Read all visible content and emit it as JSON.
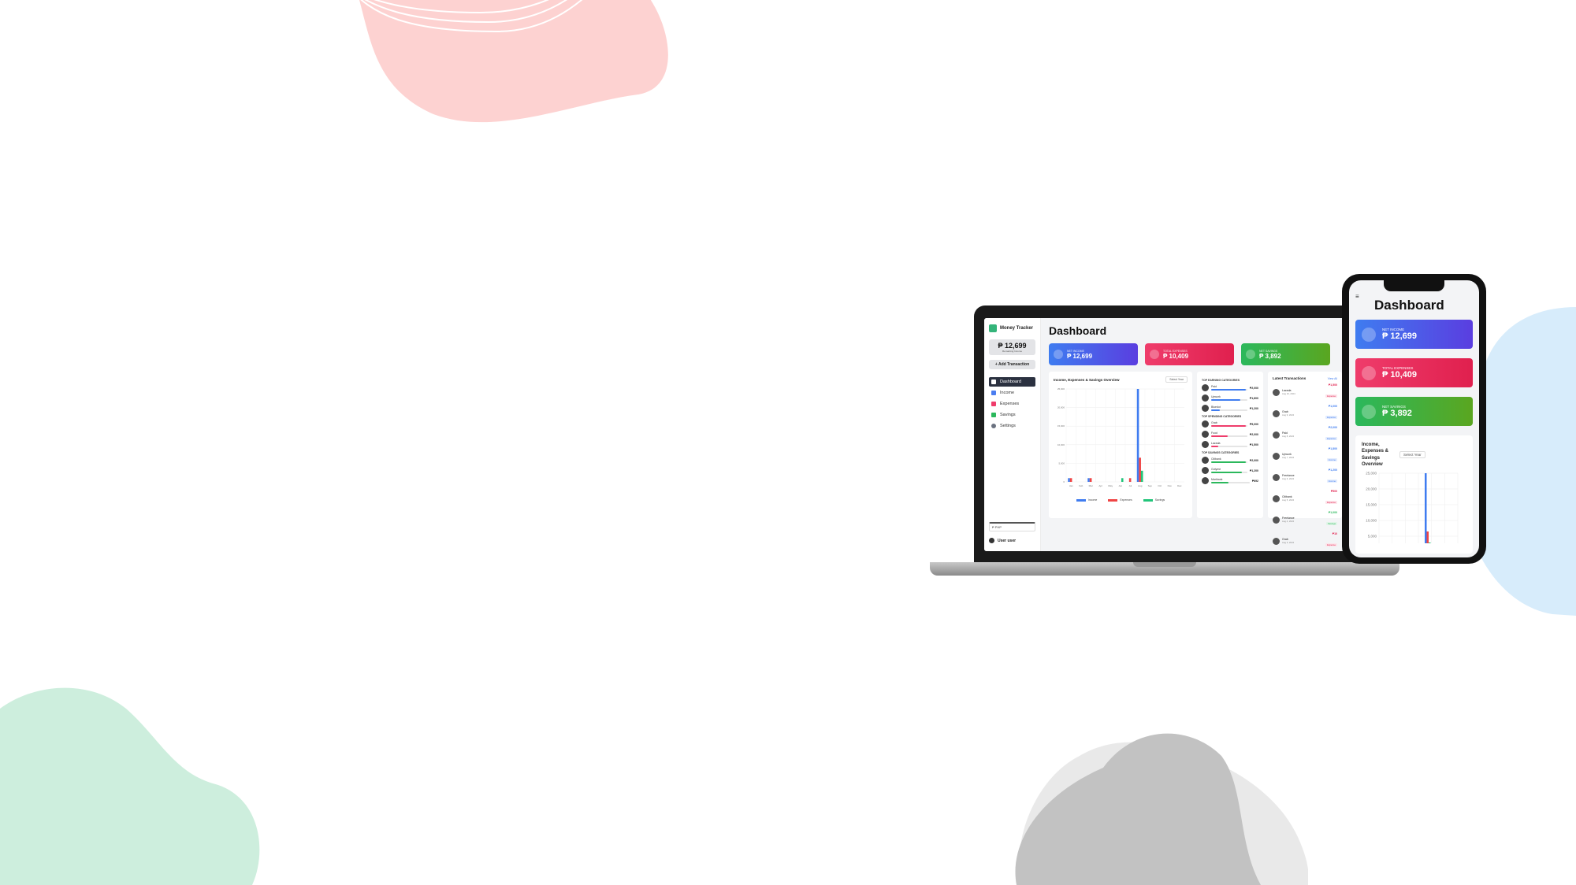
{
  "laptop": {
    "brand": "Money Tracker",
    "balance": "₱ 12,699",
    "balance_label": "Remaining Income",
    "add_transaction": "+ Add Transaction",
    "nav": [
      {
        "label": "Dashboard",
        "icon": "home-icon",
        "color": "#ffffff"
      },
      {
        "label": "Income",
        "icon": "income-icon",
        "color": "#4a7df0"
      },
      {
        "label": "Expenses",
        "icon": "expenses-icon",
        "color": "#ef3c6b"
      },
      {
        "label": "Savings",
        "icon": "savings-icon",
        "color": "#2bb85c"
      },
      {
        "label": "Settings",
        "icon": "settings-icon",
        "color": "#6b7280"
      }
    ],
    "currency": "₱ PHP",
    "user": "User user",
    "title": "Dashboard",
    "cards": [
      {
        "label": "NET INCOME",
        "value": "₱ 12,699",
        "icon": "wallet-icon"
      },
      {
        "label": "TOTAL EXPENSES",
        "value": "₱ 10,409",
        "icon": "card-icon"
      },
      {
        "label": "NET SAVINGS",
        "value": "₱ 3,892",
        "icon": "piggy-bank-icon"
      }
    ],
    "chart_title": "Income, Expenses & Savings Overview",
    "chart_select": "Select Year",
    "cats": {
      "earning_title": "TOP EARNING CATEGORIES",
      "spending_title": "TOP SPENDING CATEGORIES",
      "savings_title": "TOP SAVINGS CATEGORIES",
      "earning": [
        {
          "name": "Paid",
          "value": "₱2,000",
          "fill": 0.95,
          "color": "#3f7cf0"
        },
        {
          "name": "Upwork",
          "value": "₱1,800",
          "fill": 0.8,
          "color": "#3f7cf0"
        },
        {
          "name": "Bluedot",
          "value": "₱1,200",
          "fill": 0.25,
          "color": "#3f7cf0"
        }
      ],
      "spending": [
        {
          "name": "Grab",
          "value": "₱5,000",
          "fill": 0.95,
          "color": "#ef3c6b"
        },
        {
          "name": "Food",
          "value": "₱2,000",
          "fill": 0.45,
          "color": "#ef3c6b"
        },
        {
          "name": "Lazada",
          "value": "₱1,500",
          "fill": 0.2,
          "color": "#ef3c6b"
        }
      ],
      "savings": [
        {
          "name": "Citibank",
          "value": "₱2,000",
          "fill": 0.95,
          "color": "#2bb85c"
        },
        {
          "name": "Gotyme",
          "value": "₱1,200",
          "fill": 0.85,
          "color": "#2bb85c"
        },
        {
          "name": "Maribank",
          "value": "₱692",
          "fill": 0.45,
          "color": "#2bb85c"
        }
      ]
    },
    "tx_title": "Latest Transactions",
    "tx_link": "View All",
    "transactions": [
      {
        "name": "Lazada",
        "date": "Aug 10, 2024",
        "amount": "₱1,500",
        "type": "Expense",
        "color": "#e0204e",
        "bg": "#fde4ea"
      },
      {
        "name": "Grab",
        "date": "Aug 9, 2024",
        "amount": "₱1,000",
        "type": "Expense",
        "color": "#3f7cf0",
        "bg": "#e3ecfd"
      },
      {
        "name": "Paid",
        "date": "Aug 8, 2024",
        "amount": "₱2,000",
        "type": "Expense",
        "color": "#3f7cf0",
        "bg": "#e3ecfd"
      },
      {
        "name": "Upwork",
        "date": "Aug 7, 2024",
        "amount": "₱1,800",
        "type": "Income",
        "color": "#3f7cf0",
        "bg": "#e3ecfd"
      },
      {
        "name": "Freelance",
        "date": "Aug 6, 2024",
        "amount": "₱1,200",
        "type": "Income",
        "color": "#3f7cf0",
        "bg": "#e3ecfd"
      },
      {
        "name": "Citibank",
        "date": "Aug 5, 2024",
        "amount": "₱500",
        "type": "Expense",
        "color": "#e0204e",
        "bg": "#fde4ea"
      },
      {
        "name": "Freelance",
        "date": "Aug 4, 2024",
        "amount": "₱1,000",
        "type": "Savings",
        "color": "#2bb85c",
        "bg": "#e1f5e8"
      },
      {
        "name": "Grab",
        "date": "Aug 3, 2024",
        "amount": "₱10",
        "type": "Expense",
        "color": "#e0204e",
        "bg": "#fde4ea"
      }
    ]
  },
  "chart_data": {
    "type": "bar",
    "title": "Income, Expenses & Savings Overview",
    "categories": [
      "Jan",
      "Feb",
      "Mar",
      "Apr",
      "May",
      "Jun",
      "Jul",
      "Aug",
      "Sep",
      "Oct",
      "Nov",
      "Dec"
    ],
    "series": [
      {
        "name": "Income",
        "values": [
          1000,
          0,
          1000,
          0,
          0,
          0,
          0,
          25000,
          0,
          0,
          0,
          0
        ],
        "color": "#3f7cf0"
      },
      {
        "name": "Expenses",
        "values": [
          1000,
          0,
          1000,
          0,
          0,
          0,
          1000,
          6500,
          0,
          0,
          0,
          0
        ],
        "color": "#ef4444"
      },
      {
        "name": "Savings",
        "values": [
          0,
          0,
          0,
          0,
          0,
          1000,
          0,
          3000,
          0,
          0,
          0,
          0
        ],
        "color": "#22c57a"
      }
    ],
    "yticks": [
      "25,000",
      "20,000",
      "15,000",
      "10,000",
      "5,000",
      "0"
    ],
    "ylim": [
      0,
      25000
    ]
  },
  "phone": {
    "menu_icon": "≡",
    "title": "Dashboard",
    "cards": [
      {
        "label": "NET INCOME",
        "value": "₱ 12,699"
      },
      {
        "label": "TOTAL EXPENSES",
        "value": "₱ 10,409"
      },
      {
        "label": "NET SAVINGS",
        "value": "₱ 3,892"
      }
    ],
    "chart_title": "Income, Expenses & Savings Overview",
    "chart_select": "Select Year",
    "yticks": [
      "25,000",
      "20,000",
      "15,000",
      "10,000",
      "5,000"
    ]
  }
}
